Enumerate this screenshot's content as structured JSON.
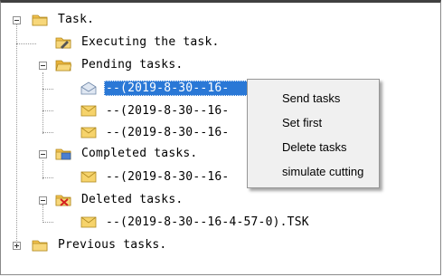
{
  "tree": {
    "root": {
      "label": "Task.",
      "icon": "folder-icon"
    },
    "executing": {
      "label": "Executing the task.",
      "icon": "folder-pencil-icon"
    },
    "pending": {
      "label": "Pending tasks.",
      "icon": "open-folder-icon",
      "items": [
        {
          "label": "--(2019-8-30--16-",
          "icon": "envelope-open-icon",
          "selected": true
        },
        {
          "label": "--(2019-8-30--16-",
          "icon": "envelope-icon"
        },
        {
          "label": "--(2019-8-30--16-",
          "icon": "envelope-icon"
        }
      ]
    },
    "completed": {
      "label": "Completed tasks.",
      "icon": "folder-check-icon",
      "items": [
        {
          "label": "--(2019-8-30--16-",
          "icon": "envelope-icon"
        }
      ]
    },
    "deleted": {
      "label": "Deleted tasks.",
      "icon": "folder-delete-icon",
      "items": [
        {
          "label": "--(2019-8-30--16-4-57-0).TSK",
          "icon": "envelope-icon"
        }
      ]
    },
    "previous": {
      "label": "Previous tasks.",
      "icon": "folder-icon"
    }
  },
  "context_menu": {
    "items": [
      "Send tasks",
      "Set first",
      "Delete tasks",
      "simulate cutting"
    ]
  },
  "colors": {
    "selection": "#2a78d6",
    "menu_bg": "#f0f0f0",
    "folder": "#f2c14e"
  }
}
